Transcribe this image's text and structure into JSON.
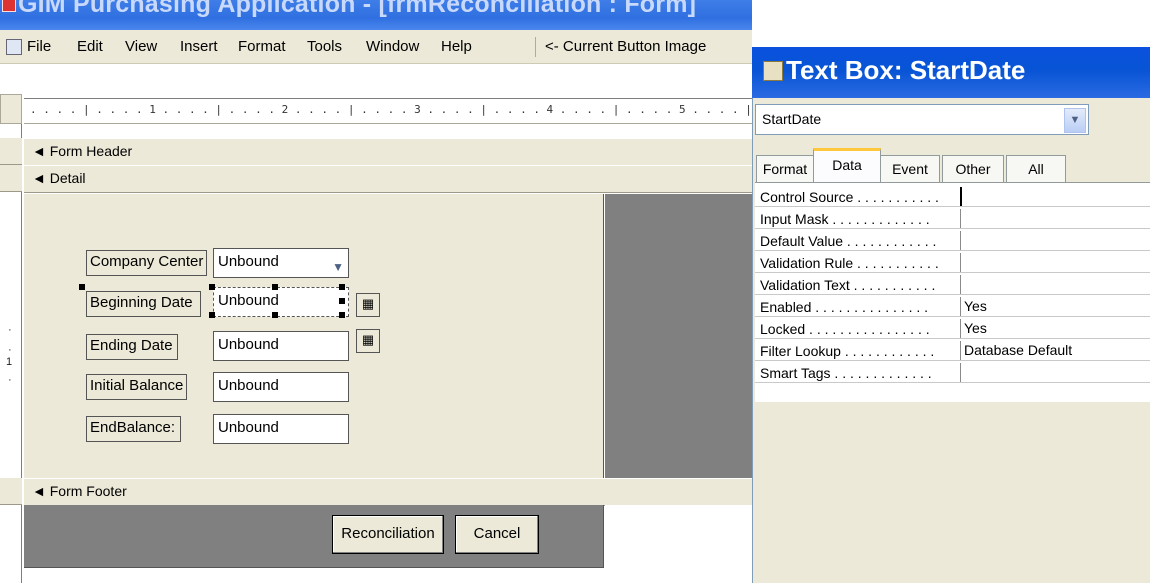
{
  "app": {
    "title": "GIM Purchasing Application - [frmReconciliation : Form]"
  },
  "menu": {
    "items": [
      "File",
      "Edit",
      "View",
      "Insert",
      "Format",
      "Tools",
      "Window",
      "Help"
    ],
    "extra": "<- Current Button Image"
  },
  "ruler": {
    "marks": ". . . . | . . . . 1 . . . . | . . . . 2 . . . . | . . . . 3 . . . . | . . . . 4 . . . . | . . . . 5 . . . . |",
    "vertical_tick": "1"
  },
  "sections": {
    "form_header": "Form Header",
    "detail": "Detail",
    "form_footer": "Form Footer"
  },
  "form": {
    "fields": [
      {
        "label": "Company Center",
        "value": "Unbound"
      },
      {
        "label": "Beginning Date",
        "value": "Unbound"
      },
      {
        "label": "Ending Date",
        "value": "Unbound"
      },
      {
        "label": "Initial Balance",
        "value": "Unbound"
      },
      {
        "label": "EndBalance:",
        "value": "Unbound"
      }
    ],
    "buttons": {
      "reconciliation": "Reconciliation",
      "cancel": "Cancel"
    }
  },
  "property_sheet": {
    "title": "Text Box: StartDate",
    "selected_object": "StartDate",
    "tabs": [
      "Format",
      "Data",
      "Event",
      "Other",
      "All"
    ],
    "active_tab": "Data",
    "properties": [
      {
        "name": "Control Source . . . . . . . . . . .",
        "value": ""
      },
      {
        "name": "Input Mask . . . . . . . . . . . . .",
        "value": ""
      },
      {
        "name": "Default Value . . . . . . . . . . . .",
        "value": ""
      },
      {
        "name": "Validation Rule . . . . . . . . . . .",
        "value": ""
      },
      {
        "name": "Validation Text . . . . . . . . . . .",
        "value": ""
      },
      {
        "name": "Enabled . . . . . . . . . . . . . . .",
        "value": "Yes"
      },
      {
        "name": "Locked . . . . . . . . . . . . . . . .",
        "value": "Yes"
      },
      {
        "name": "Filter Lookup . . . . . . . . . . . .",
        "value": "Database Default"
      },
      {
        "name": "Smart Tags . . . . . . . . . . . . .",
        "value": ""
      }
    ]
  },
  "colors": {
    "title_blue": "#0a52df",
    "dialog_face": "#ece9d8",
    "design_grey": "#808080",
    "tab_highlight": "#ffc83c"
  }
}
